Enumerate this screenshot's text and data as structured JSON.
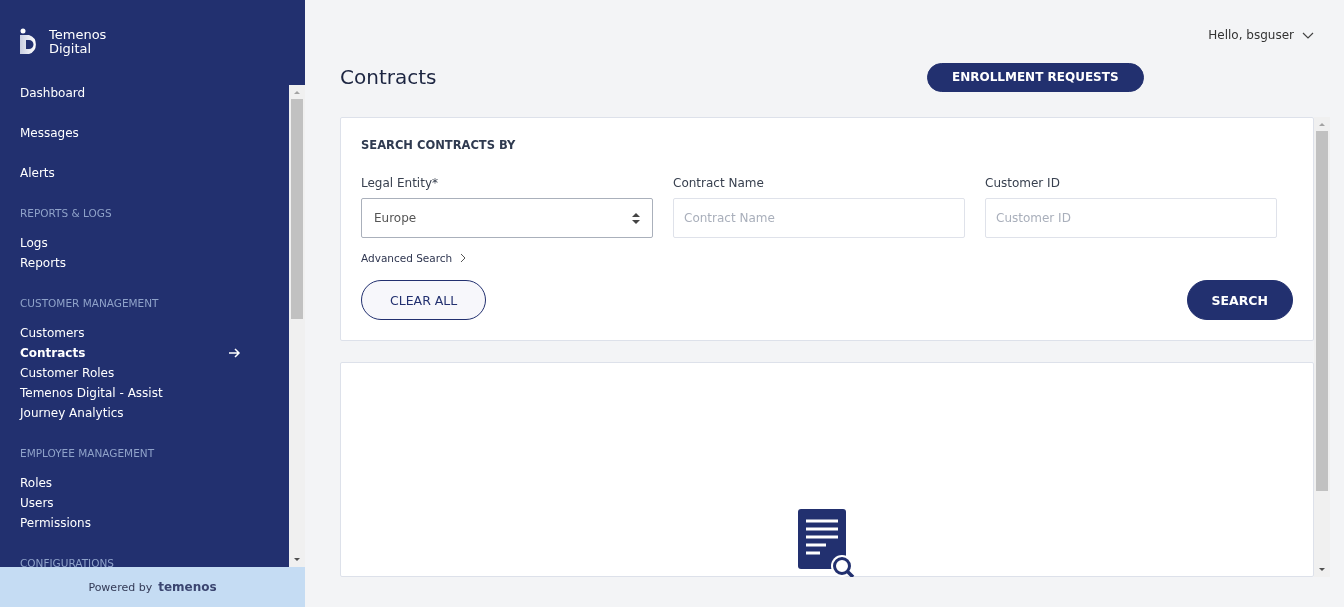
{
  "sidebar": {
    "logo": {
      "line_1": "Temenos",
      "line_2": "Digital"
    },
    "sections": [
      {
        "items": [
          {
            "label": "Dashboard",
            "selected": false
          },
          {
            "label": "Messages",
            "selected": false
          },
          {
            "label": "Alerts",
            "selected": false
          }
        ]
      },
      {
        "heading": "REPORTS & LOGS",
        "items": [
          {
            "label": "Logs",
            "selected": false
          },
          {
            "label": "Reports",
            "selected": false
          }
        ]
      },
      {
        "heading": "CUSTOMER MANAGEMENT",
        "items": [
          {
            "label": "Customers",
            "selected": false
          },
          {
            "label": "Contracts",
            "selected": true
          },
          {
            "label": "Customer Roles",
            "selected": false
          },
          {
            "label": "Temenos Digital - Assist",
            "selected": false
          },
          {
            "label": "Journey Analytics",
            "selected": false
          }
        ]
      },
      {
        "heading": "EMPLOYEE MANAGEMENT",
        "items": [
          {
            "label": "Roles",
            "selected": false
          },
          {
            "label": "Users",
            "selected": false
          },
          {
            "label": "Permissions",
            "selected": false
          }
        ]
      },
      {
        "heading": "CONFIGURATIONS"
      }
    ],
    "footer": {
      "prefix": "Powered by",
      "brand": "temenos"
    }
  },
  "header": {
    "user_menu": "Hello, bsguser"
  },
  "page": {
    "title": "Contracts",
    "action_button": "ENROLLMENT REQUESTS"
  },
  "search_card": {
    "heading": "SEARCH CONTRACTS BY",
    "fields": [
      {
        "kind": "select",
        "label": "Legal Entity*",
        "value": "Europe"
      },
      {
        "kind": "text",
        "label": "Contract Name",
        "placeholder": "Contract Name"
      },
      {
        "kind": "text",
        "label": "Customer ID",
        "placeholder": "Customer ID"
      }
    ],
    "advanced_link": "Advanced Search",
    "clear_button": "CLEAR ALL",
    "search_button": "SEARCH"
  }
}
